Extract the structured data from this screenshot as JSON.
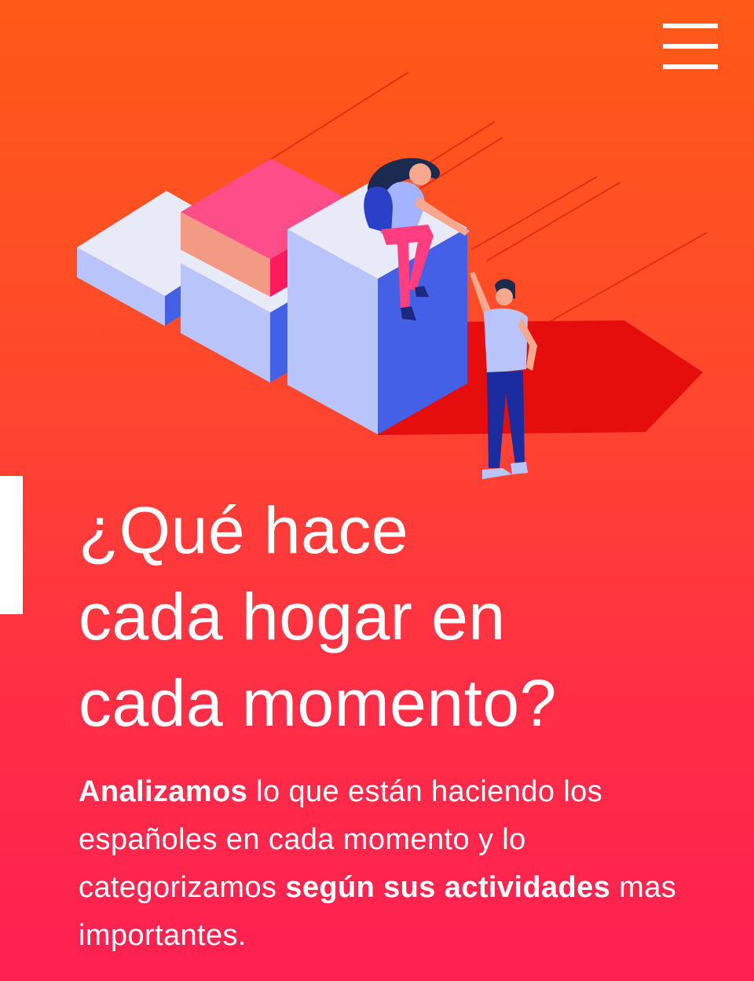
{
  "header": {
    "menu_icon": "hamburger-menu-icon"
  },
  "hero": {
    "illustration": "isometric-blocks-with-people",
    "colors": {
      "background_top": "#ff5a17",
      "background_bottom": "#ff2052",
      "block_top": "#e8eaf8",
      "block_side": "#b9c4fb",
      "block_dark": "#4460e6",
      "pink_block": "#ff4d8a",
      "shadow": "#e60d0d"
    }
  },
  "headline": {
    "line1": "¿Qué hace",
    "line2": "cada hogar en",
    "line3": "cada momento?"
  },
  "intro": {
    "bold1": "Analizamos",
    "text1": " lo que están haciendo los españoles en cada momento y lo categorizamos ",
    "bold2": "según sus actividades",
    "text2": " mas importantes."
  }
}
